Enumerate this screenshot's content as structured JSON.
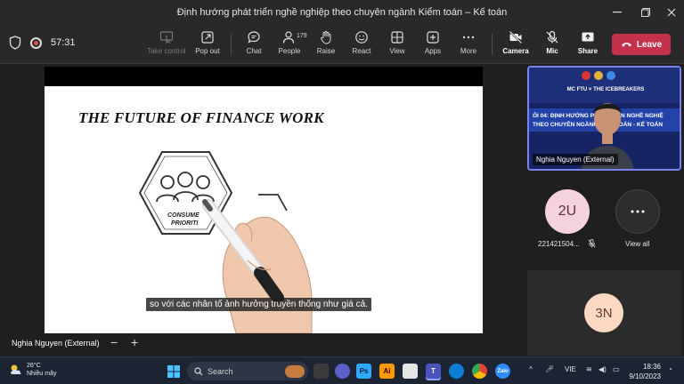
{
  "window": {
    "title": "Định hướng phát triển nghề nghiệp theo chuyên ngành Kiểm toán – Kế toán"
  },
  "toolbar": {
    "timer": "57:31",
    "take_control": "Take control",
    "pop_out": "Pop out",
    "chat": "Chat",
    "people": "People",
    "people_count": "179",
    "raise": "Raise",
    "react": "React",
    "view": "View",
    "apps": "Apps",
    "more": "More",
    "camera": "Camera",
    "mic": "Mic",
    "share": "Share",
    "leave": "Leave",
    "leave_color": "#c4314b"
  },
  "slide": {
    "title": "THE FUTURE OF FINANCE WORK",
    "hex_text_1": "CONSUME",
    "hex_text_2": "PRIORITI",
    "subtitle": "so với các nhân tố ảnh hưởng truyền thống như giá cả."
  },
  "presenter": {
    "name": "Nghia Nguyen (External)"
  },
  "participants": {
    "video_name": "Nghia Nguyen (External)",
    "banner_line1": "MC FTU × THE ICEBREAKERS",
    "banner_line2": "ỐI 04: ĐỊNH HƯỚNG PHÁT TRIỂN NGHỀ NGHIỆ",
    "banner_line3": "THEO CHUYÊN NGÀNH KIỂM TOÁN - KẾ TOÁN",
    "p1_initials": "2U",
    "p1_name": "221421504...",
    "view_all": "View all",
    "p2_initials": "3N"
  },
  "taskbar": {
    "temp": "26°C",
    "weather": "Nhiều mây",
    "search": "Search",
    "lang": "VIE",
    "time": "18:36",
    "date": "9/10/2023"
  }
}
